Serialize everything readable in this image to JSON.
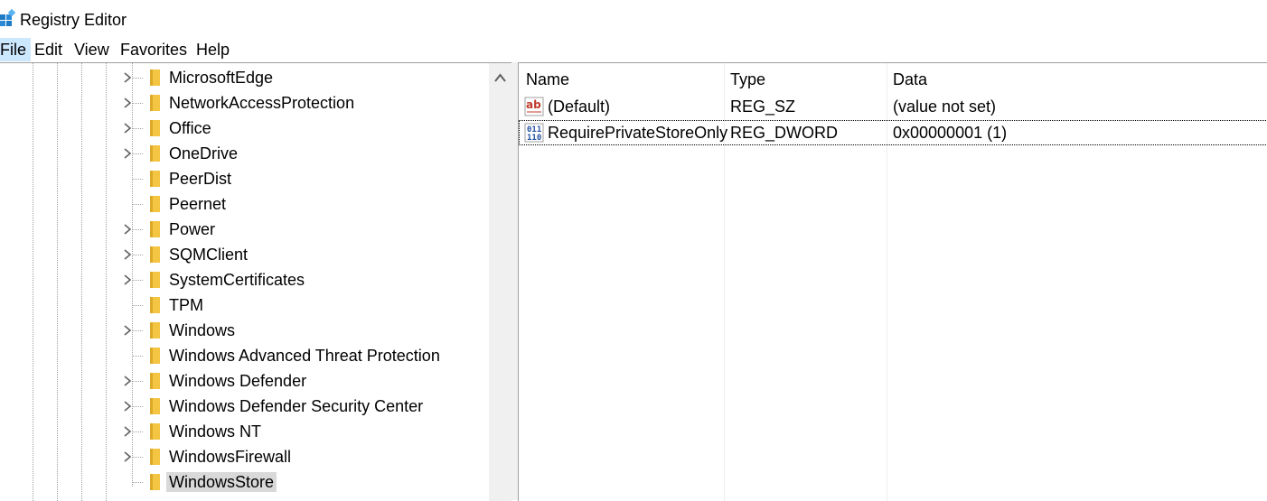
{
  "window": {
    "title": "Registry Editor"
  },
  "menu": {
    "items": [
      {
        "label": "File",
        "active": true
      },
      {
        "label": "Edit"
      },
      {
        "label": "View"
      },
      {
        "label": "Favorites"
      },
      {
        "label": "Help"
      }
    ]
  },
  "tree": {
    "items": [
      {
        "label": "MicrosoftEdge",
        "expandable": true
      },
      {
        "label": "NetworkAccessProtection",
        "expandable": true
      },
      {
        "label": "Office",
        "expandable": true
      },
      {
        "label": "OneDrive",
        "expandable": true
      },
      {
        "label": "PeerDist",
        "expandable": false
      },
      {
        "label": "Peernet",
        "expandable": false
      },
      {
        "label": "Power",
        "expandable": true
      },
      {
        "label": "SQMClient",
        "expandable": true
      },
      {
        "label": "SystemCertificates",
        "expandable": true
      },
      {
        "label": "TPM",
        "expandable": false
      },
      {
        "label": "Windows",
        "expandable": true
      },
      {
        "label": "Windows Advanced Threat Protection",
        "expandable": false
      },
      {
        "label": "Windows Defender",
        "expandable": true
      },
      {
        "label": "Windows Defender Security Center",
        "expandable": true
      },
      {
        "label": "Windows NT",
        "expandable": true
      },
      {
        "label": "WindowsFirewall",
        "expandable": true
      },
      {
        "label": "WindowsStore",
        "expandable": false,
        "selected": true
      }
    ]
  },
  "values": {
    "columns": [
      "Name",
      "Type",
      "Data"
    ],
    "rows": [
      {
        "name": "(Default)",
        "type": "REG_SZ",
        "data": "(value not set)",
        "icon": "string-value-icon"
      },
      {
        "name": "RequirePrivateStoreOnly",
        "type": "REG_DWORD",
        "data": "0x00000001 (1)",
        "icon": "binary-value-icon",
        "focused": true
      }
    ]
  },
  "colors": {
    "folder": "#f4c542",
    "folderDark": "#dcaa28",
    "selection": "#d9d9d9",
    "menuActive": "#cce8ff"
  }
}
